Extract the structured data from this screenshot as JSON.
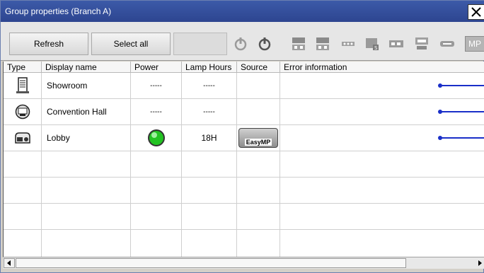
{
  "window": {
    "title": "Group properties (Branch A)"
  },
  "toolbar": {
    "refresh_label": "Refresh",
    "select_all_label": "Select all",
    "mp_label": "MP"
  },
  "table": {
    "columns": [
      "Type",
      "Display name",
      "Power",
      "Lamp Hours",
      "Source",
      "Error information"
    ],
    "rows": [
      {
        "type_icon": "tower-projector-icon",
        "name": "Showroom",
        "power": "-----",
        "lamp_hours": "-----",
        "source": "",
        "error": ""
      },
      {
        "type_icon": "round-projector-icon",
        "name": "Convention Hall",
        "power": "-----",
        "lamp_hours": "-----",
        "source": "",
        "error": ""
      },
      {
        "type_icon": "projector-icon",
        "name": "Lobby",
        "power": "power-on-green-icon",
        "lamp_hours": "18H",
        "source": "EasyMP",
        "error": ""
      }
    ]
  },
  "colors": {
    "title_bar": "#2d4590",
    "leader_line": "#1a2fc8",
    "power_on": "#22c322"
  }
}
